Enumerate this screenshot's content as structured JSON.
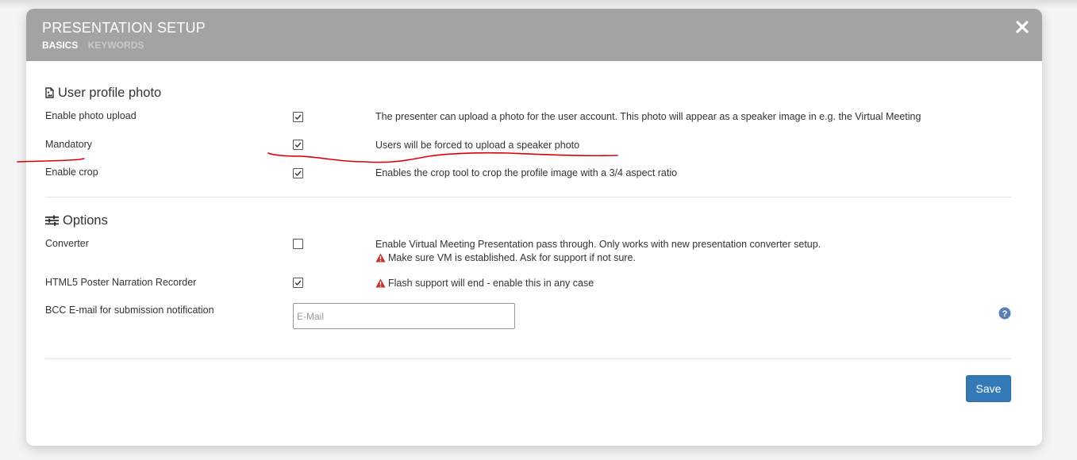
{
  "modal": {
    "title": "PRESENTATION SETUP",
    "tabs": [
      {
        "label": "BASICS",
        "active": true
      },
      {
        "label": "KEYWORDS",
        "active": false
      }
    ]
  },
  "photo_section": {
    "title": "User profile photo",
    "icon": "image-file-icon",
    "rows": [
      {
        "label": "Enable photo upload",
        "checked": true,
        "description": "The presenter can upload a photo for the user account. This photo will appear as a speaker image in e.g. the Virtual Meeting"
      },
      {
        "label": "Mandatory",
        "checked": true,
        "description": "Users will be forced to upload a speaker photo"
      },
      {
        "label": "Enable crop",
        "checked": true,
        "description": "Enables the crop tool to crop the profile image with a 3/4 aspect ratio"
      }
    ]
  },
  "options_section": {
    "title": "Options",
    "icon": "sliders-icon",
    "converter": {
      "label": "Converter",
      "checked": false,
      "description": "Enable Virtual Meeting Presentation pass through. Only works with new presentation converter setup.",
      "warning": "Make sure VM is established. Ask for support if not sure."
    },
    "html5": {
      "label": "HTML5 Poster Narration Recorder",
      "checked": true,
      "warning": "Flash support will end - enable this in any case"
    },
    "bcc": {
      "label": "BCC E-mail for submission notification",
      "value": "",
      "placeholder": "E-Mail"
    }
  },
  "footer": {
    "save_label": "Save"
  },
  "colors": {
    "header_bg": "#a3a3a3",
    "primary_button": "#337ab7",
    "warning": "#c9302c",
    "help_icon": "#5b7fb5",
    "annotation": "#e00000"
  }
}
